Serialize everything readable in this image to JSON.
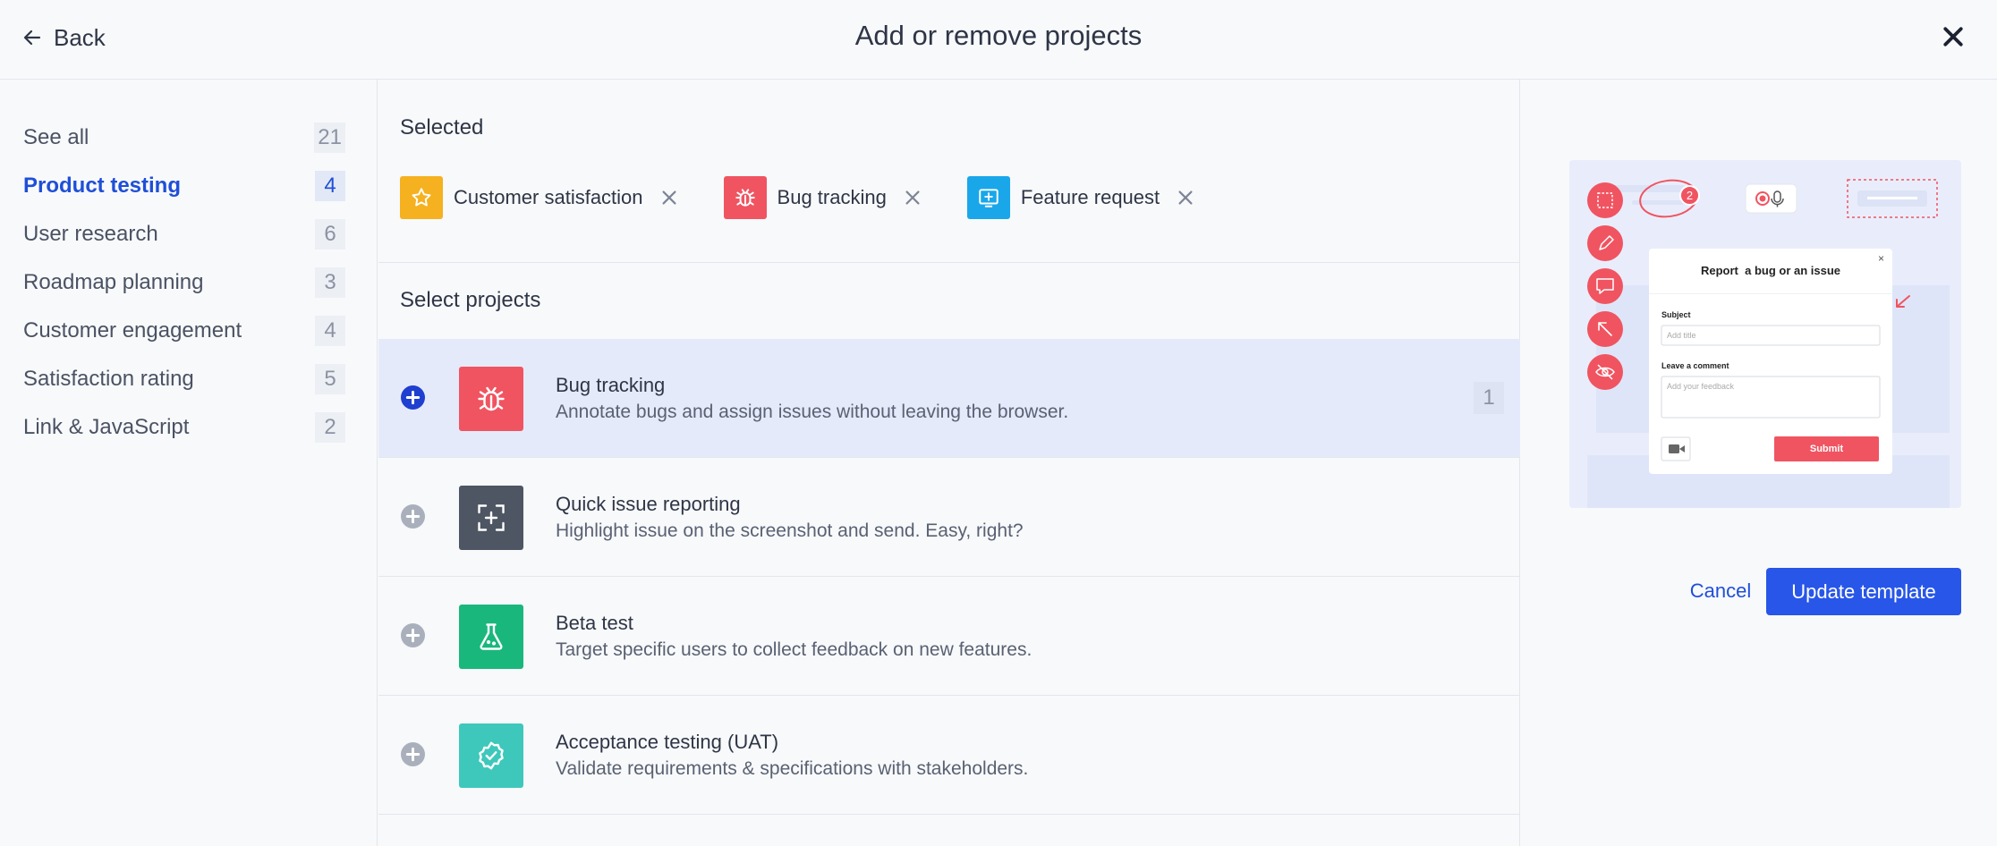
{
  "header": {
    "back_label": "Back",
    "title": "Add or remove projects"
  },
  "sidebar": {
    "items": [
      {
        "label": "See all",
        "count": "21"
      },
      {
        "label": "Product testing",
        "count": "4",
        "active": true
      },
      {
        "label": "User research",
        "count": "6"
      },
      {
        "label": "Roadmap planning",
        "count": "3"
      },
      {
        "label": "Customer engagement",
        "count": "4"
      },
      {
        "label": "Satisfaction rating",
        "count": "5"
      },
      {
        "label": "Link & JavaScript",
        "count": "2"
      }
    ]
  },
  "selected": {
    "heading": "Selected",
    "chips": [
      {
        "label": "Customer satisfaction",
        "icon": "star-icon",
        "color": "#f5b120"
      },
      {
        "label": "Bug tracking",
        "icon": "bug-icon",
        "color": "#f05461"
      },
      {
        "label": "Feature request",
        "icon": "feature-request-icon",
        "color": "#19a7ea"
      }
    ]
  },
  "projects": {
    "heading": "Select projects",
    "rows": [
      {
        "name": "Bug tracking",
        "desc": "Annotate bugs and assign issues without leaving the browser.",
        "icon": "bug-icon",
        "color": "#f05461",
        "count": "1",
        "selected": true
      },
      {
        "name": "Quick issue reporting",
        "desc": "Highlight issue on the screenshot and send. Easy, right?",
        "icon": "screenshot-plus-icon",
        "color": "#4e5663"
      },
      {
        "name": "Beta test",
        "desc": "Target specific users to collect feedback on new features.",
        "icon": "flask-icon",
        "color": "#1ab77d"
      },
      {
        "name": "Acceptance testing (UAT)",
        "desc": "Validate requirements & specifications with stakeholders.",
        "icon": "badge-check-icon",
        "color": "#3ec8bb"
      }
    ]
  },
  "preview": {
    "badge_count": "2",
    "modal_title": "Report  a bug or an issue",
    "modal_close": "×",
    "subject_label": "Subject",
    "subject_placeholder": "Add title",
    "comment_label": "Leave a comment",
    "comment_placeholder": "Add your feedback",
    "submit_label": "Submit"
  },
  "actions": {
    "cancel_label": "Cancel",
    "update_label": "Update template"
  },
  "colors": {
    "accent": "#2856e8",
    "active_text": "#1f4fd8",
    "selected_row_bg": "#e5eafb",
    "red": "#f05461"
  }
}
